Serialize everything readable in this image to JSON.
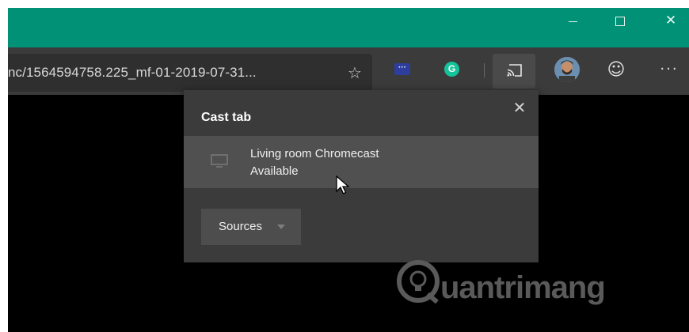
{
  "window": {
    "minimize_icon": "minimize-icon",
    "maximize_icon": "maximize-icon",
    "close_glyph": "✕"
  },
  "toolbar": {
    "address_url": "nc/1564594758.225_mf-01-2019-07-31...",
    "favorite_glyph": "☆",
    "extension_glyph": "···",
    "grammarly_letter": "G",
    "smiley_glyph": "☺",
    "more_glyph": "···"
  },
  "cast_popup": {
    "title": "Cast tab",
    "close_glyph": "✕",
    "device": {
      "name": "Living room Chromecast",
      "status": "Available"
    },
    "sources_label": "Sources"
  },
  "watermark": {
    "text": "uantrimang",
    "logo_letter": "Q"
  },
  "colors": {
    "titlebar": "#009177",
    "toolbar": "#3b3b3b",
    "popup": "#3b3b3b",
    "device_row": "#505050",
    "grammarly": "#15c39a"
  }
}
